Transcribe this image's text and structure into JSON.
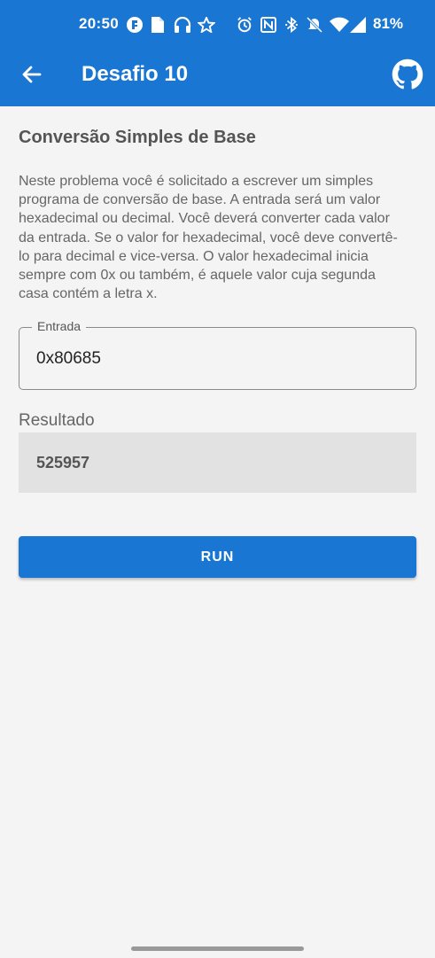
{
  "status_bar": {
    "time": "20:50",
    "battery": "81%",
    "icons": [
      "app-f-icon",
      "document-icon",
      "headset-icon",
      "star-icon",
      "alarm-icon",
      "nfc-icon",
      "bluetooth-icon",
      "bell-off-icon",
      "wifi-icon",
      "signal-icon"
    ]
  },
  "toolbar": {
    "title": "Desafio 10",
    "back_icon": "arrow-left-icon",
    "github_icon": "github-icon",
    "background_color": "#1976d2"
  },
  "content": {
    "heading": "Conversão Simples de Base",
    "description": "Neste problema você é solicitado a escrever um simples programa de conversão de base. A entrada será um valor hexadecimal ou decimal. Você deverá converter cada valor da entrada. Se o valor for hexadecimal, você deve convertê-lo para decimal e vice-versa. O valor hexadecimal inicia sempre com 0x ou também, é aquele valor cuja segunda casa contém a letra x.",
    "input": {
      "label": "Entrada",
      "value": "0x80685"
    },
    "result": {
      "label": "Resultado",
      "value": "525957"
    },
    "run_button": "RUN"
  }
}
